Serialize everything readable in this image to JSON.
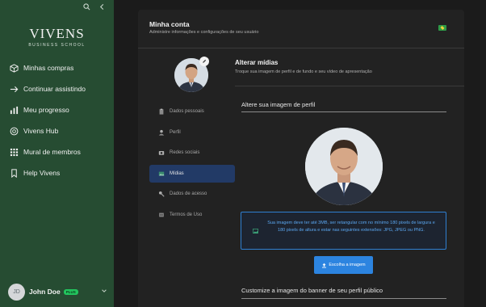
{
  "sidebar": {
    "logo_line1": "VIVENS",
    "logo_line2": "BUSINESS SCHOOL",
    "items": [
      {
        "label": "Minhas compras",
        "icon": "box-icon"
      },
      {
        "label": "Continuar assistindo",
        "icon": "arrow-right-icon"
      },
      {
        "label": "Meu progresso",
        "icon": "bar-chart-icon"
      },
      {
        "label": "Vivens Hub",
        "icon": "compass-icon"
      },
      {
        "label": "Mural de membros",
        "icon": "grid-icon"
      },
      {
        "label": "Help Vivens",
        "icon": "bookmark-icon"
      }
    ],
    "user": {
      "initials": "JD",
      "name": "John Doe",
      "badge": "PLUS"
    }
  },
  "header": {
    "title": "Minha conta",
    "subtitle": "Administre informações e configurações de seu usuário"
  },
  "account_menu": [
    {
      "label": "Dados pessoais",
      "icon": "clipboard-icon",
      "active": false
    },
    {
      "label": "Perfil",
      "icon": "user-icon",
      "active": false
    },
    {
      "label": "Redes sociais",
      "icon": "camera-icon",
      "active": false
    },
    {
      "label": "Mídias",
      "icon": "image-icon",
      "active": true
    },
    {
      "label": "Dados de acesso",
      "icon": "key-icon",
      "active": false
    },
    {
      "label": "Termos de Uso",
      "icon": "document-icon",
      "active": false
    }
  ],
  "section": {
    "title": "Alterar mídias",
    "subtitle": "Troque sua imagem de perfil e de fundo e seu vídeo de apresentação",
    "profile_title": "Altere sua imagem de perfil",
    "info_text": "Sua imagem deve ter até 3MB, ser retangular com no mínimo 180 pixels de largura e 180 pixels de altura e estar nas seguintes extensões: JPG, JPEG ou PNG.",
    "upload_label": "Escolha a imagem",
    "banner_title": "Customize a imagem do banner de seu perfil público"
  },
  "colors": {
    "sidebar_bg": "#264c32",
    "active_item_bg": "#223a66",
    "accent_blue": "#2c84e0",
    "badge_green": "#22c55e"
  }
}
